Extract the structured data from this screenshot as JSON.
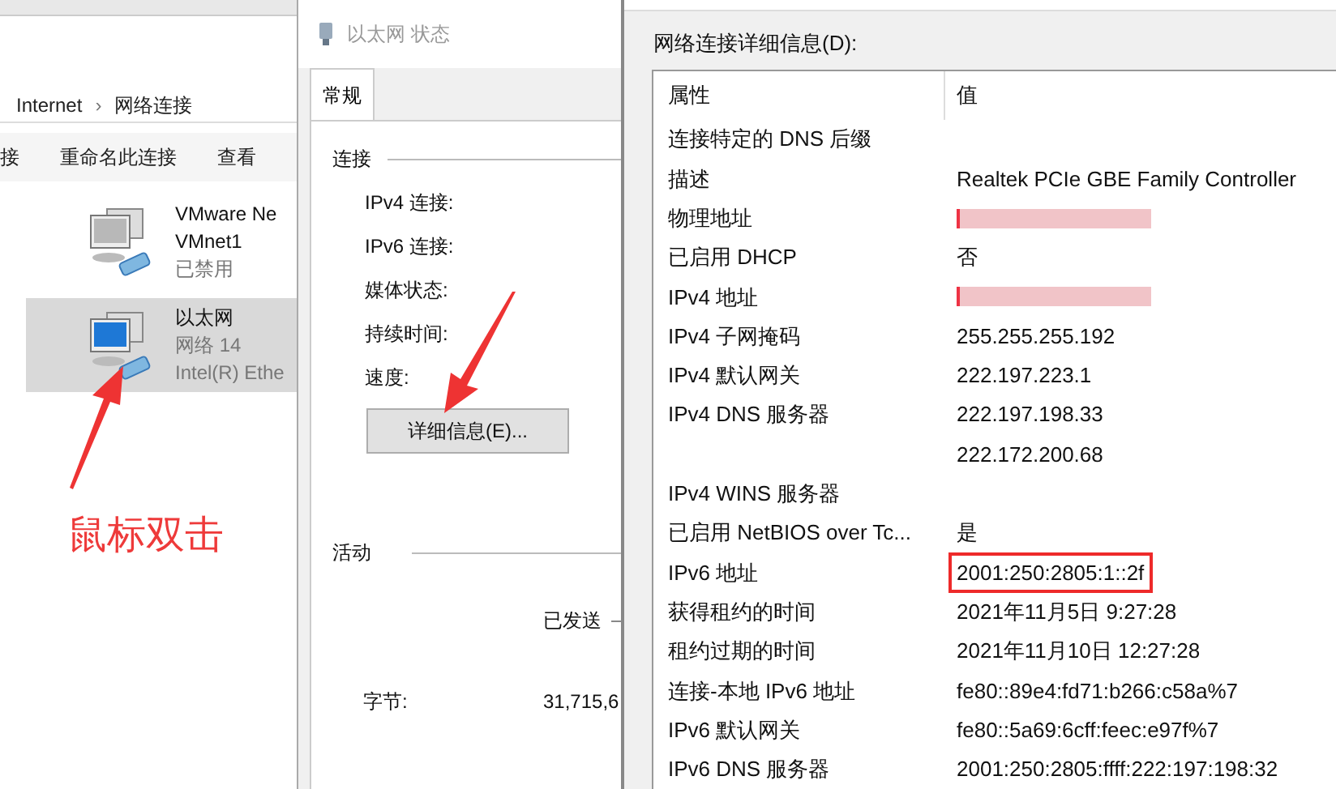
{
  "explorer": {
    "breadcrumb": [
      "Internet",
      "›",
      "网络连接"
    ],
    "toolbar": [
      "接",
      "重命名此连接",
      "查看"
    ],
    "items": [
      {
        "name": "VMware Ne",
        "line2": "VMnet1",
        "line3": "已禁用",
        "selected": false,
        "kind": "gray"
      },
      {
        "name": "以太网",
        "line2": "网络 14",
        "line3": "Intel(R) Ethe",
        "selected": true,
        "kind": "blue"
      }
    ]
  },
  "status_dialog": {
    "title": "以太网 状态",
    "tabs": [
      {
        "label": "常规",
        "selected": true
      }
    ],
    "connection": {
      "heading": "连接",
      "labels": [
        "IPv4 连接:",
        "IPv6 连接:",
        "媒体状态:",
        "持续时间:",
        "速度:"
      ],
      "button": "详细信息(E)..."
    },
    "activity": {
      "heading": "活动",
      "sent": "已发送",
      "bytes_label": "字节:",
      "bytes_value": "31,715,6"
    }
  },
  "details_dialog": {
    "label": "网络连接详细信息(D):",
    "columns": [
      "属性",
      "值"
    ],
    "rows": [
      {
        "property": "连接特定的 DNS 后缀",
        "kind": "text"
      },
      {
        "property": "描述",
        "kind": "text",
        "value": "Realtek PCIe GBE Family Controller"
      },
      {
        "property": "物理地址",
        "kind": "redacted"
      },
      {
        "property": "已启用 DHCP",
        "kind": "text",
        "value": "否"
      },
      {
        "property": "IPv4 地址",
        "kind": "redacted"
      },
      {
        "property": "IPv4 子网掩码",
        "kind": "text",
        "value": "255.255.255.192"
      },
      {
        "property": "IPv4 默认网关",
        "kind": "text",
        "value": "222.197.223.1"
      },
      {
        "property": "IPv4 DNS 服务器",
        "kind": "text",
        "value": "222.197.198.33"
      },
      {
        "kind": "text",
        "value": "222.172.200.68"
      },
      {
        "property": "IPv4 WINS 服务器",
        "kind": "text"
      },
      {
        "property": "已启用 NetBIOS over Tc...",
        "kind": "text",
        "value": "是"
      },
      {
        "property": "IPv6 地址",
        "kind": "highlighted",
        "value": "2001:250:2805:1::2f"
      },
      {
        "property": "获得租约的时间",
        "kind": "text",
        "value": "2021年11月5日 9:27:28"
      },
      {
        "property": "租约过期的时间",
        "kind": "text",
        "value": "2021年11月10日 12:27:28"
      },
      {
        "property": "连接-本地 IPv6 地址",
        "kind": "text",
        "value": "fe80::89e4:fd71:b266:c58a%7"
      },
      {
        "property": "IPv6 默认网关",
        "kind": "text",
        "value": "fe80::5a69:6cff:feec:e97f%7"
      },
      {
        "property": "IPv6 DNS 服务器",
        "kind": "text",
        "value": "2001:250:2805:ffff:222:197:198:32"
      }
    ]
  },
  "annotation": {
    "caption": "鼠标双击"
  }
}
